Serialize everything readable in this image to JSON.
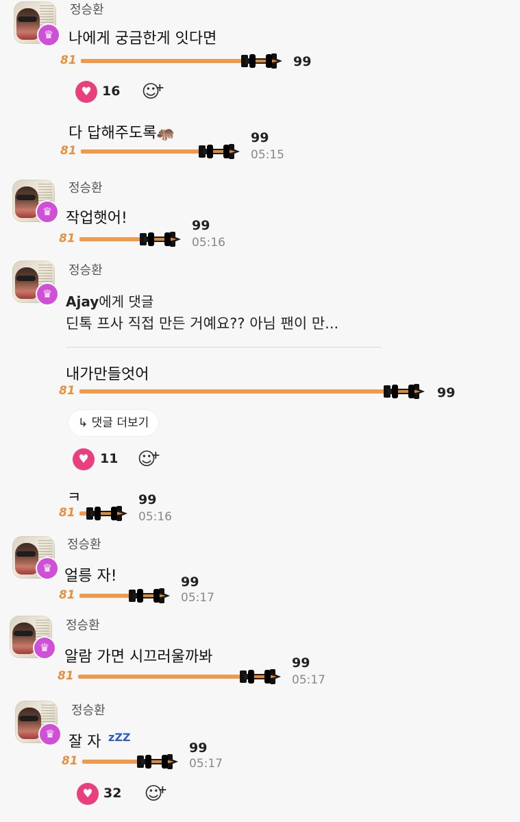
{
  "author": "정승환",
  "level_low": "81",
  "level_high": "99",
  "badge_icon": "crown-icon",
  "badge_color": "#cf4fd7",
  "bar_color": "#ee9a4c",
  "heart_color": "#ea3f7d",
  "messages": [
    {
      "text": "나에게 궁금한게 잇다면",
      "likes": "16"
    },
    {
      "text": "다 답해주도록🦛",
      "time": "05:15"
    },
    {
      "text": "작업햇어!",
      "time": "05:16"
    },
    {
      "reply_target": "Ajay",
      "reply_suffix": "에게 댓글",
      "reply_preview": "딘톡 프사 직접 만든 거예요?? 아님 팬이 만...",
      "text": "내가만들엇어",
      "more_replies": "댓글 더보기",
      "likes": "11"
    },
    {
      "text": "ㅋ",
      "time": "05:16"
    },
    {
      "text": "얼릉 자!",
      "time": "05:17"
    },
    {
      "text": "알람 가면 시끄러울까봐",
      "time": "05:17"
    },
    {
      "text": "잘 자",
      "sleep_zzz": "zZZ",
      "time": "05:17",
      "likes": "32"
    }
  ]
}
